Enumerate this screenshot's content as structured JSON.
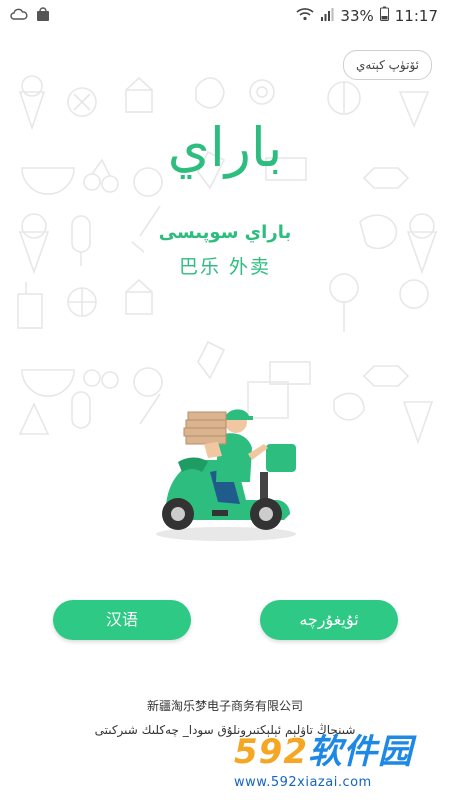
{
  "status_bar": {
    "battery": "33%",
    "time": "11:17"
  },
  "skip_label": "ئۆتۈپ كېتەي",
  "logo_text": "باراي",
  "app_name_ug": "باراي سوپىسى",
  "app_name_cn": "巴乐 外卖",
  "buttons": {
    "chinese": "汉语",
    "uyghur": "ئۇيغۇرچە"
  },
  "company_cn": "新疆淘乐梦电子商务有限公司",
  "company_ug": "شىنجاڭ تاۋلېم ئېلېكتىرونلۇق سودا_ چەكلىك شىركىتى",
  "watermark": {
    "brand_num": "592",
    "brand_text": "软件园",
    "url": "www.592xiazai.com"
  },
  "colors": {
    "accent": "#2dbd7e",
    "button": "#2dc985"
  }
}
